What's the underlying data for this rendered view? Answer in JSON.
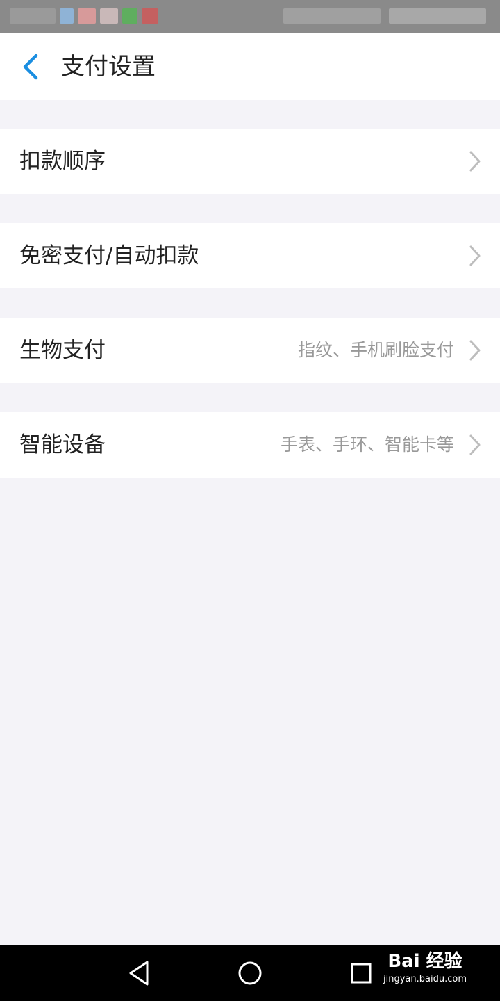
{
  "header": {
    "title": "支付设置"
  },
  "settings": {
    "items": [
      {
        "label": "扣款顺序",
        "detail": ""
      },
      {
        "label": "免密支付/自动扣款",
        "detail": ""
      },
      {
        "label": "生物支付",
        "detail": "指纹、手机刷脸支付"
      },
      {
        "label": "智能设备",
        "detail": "手表、手环、智能卡等"
      }
    ]
  },
  "watermark": {
    "logo": "Bai 经验",
    "url": "jingyan.baidu.com"
  },
  "colors": {
    "accent": "#1a8ee1",
    "background": "#f4f3f8",
    "text_primary": "#222222",
    "text_secondary": "#999999"
  },
  "icons": {
    "back": "chevron-left-icon",
    "row_arrow": "chevron-right-icon",
    "nav_back": "triangle-back-icon",
    "nav_home": "circle-home-icon",
    "nav_recents": "square-recents-icon"
  }
}
